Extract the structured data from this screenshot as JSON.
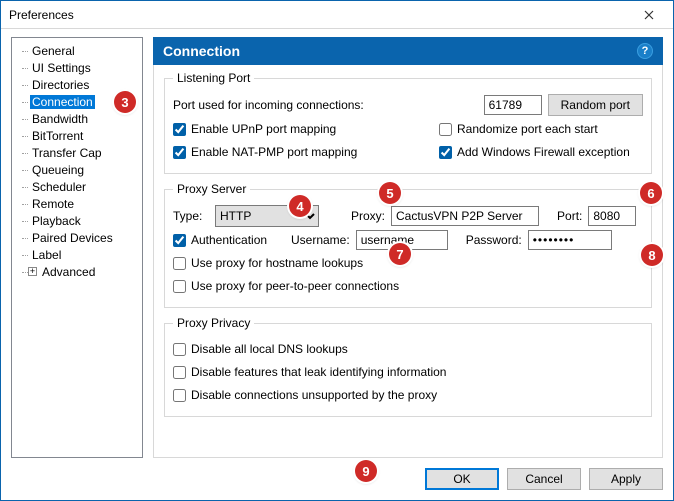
{
  "window": {
    "title": "Preferences"
  },
  "tree": {
    "items": [
      "General",
      "UI Settings",
      "Directories",
      "Connection",
      "Bandwidth",
      "BitTorrent",
      "Transfer Cap",
      "Queueing",
      "Scheduler",
      "Remote",
      "Playback",
      "Paired Devices",
      "Label",
      "Advanced"
    ],
    "selected_index": 3,
    "expandable_index": 13
  },
  "page_header": "Connection",
  "listening_port": {
    "legend": "Listening Port",
    "port_label": "Port used for incoming connections:",
    "port_value": "61789",
    "random_button": "Random port",
    "upnp": {
      "label": "Enable UPnP port mapping",
      "checked": true
    },
    "randomize": {
      "label": "Randomize port each start",
      "checked": false
    },
    "natpmp": {
      "label": "Enable NAT-PMP port mapping",
      "checked": true
    },
    "firewall": {
      "label": "Add Windows Firewall exception",
      "checked": true
    }
  },
  "proxy_server": {
    "legend": "Proxy Server",
    "type_label": "Type:",
    "type_value": "HTTP",
    "proxy_label": "Proxy:",
    "proxy_value": "CactusVPN P2P Server",
    "port_label": "Port:",
    "port_value": "8080",
    "auth": {
      "label": "Authentication",
      "checked": true
    },
    "username_label": "Username:",
    "username_value": "username",
    "password_label": "Password:",
    "password_value": "••••••••",
    "hostname_lookups": {
      "label": "Use proxy for hostname lookups",
      "checked": false
    },
    "p2p": {
      "label": "Use proxy for peer-to-peer connections",
      "checked": false
    }
  },
  "proxy_privacy": {
    "legend": "Proxy Privacy",
    "dns": {
      "label": "Disable all local DNS lookups",
      "checked": false
    },
    "leak": {
      "label": "Disable features that leak identifying information",
      "checked": false
    },
    "unsupported": {
      "label": "Disable connections unsupported by the proxy",
      "checked": false
    }
  },
  "buttons": {
    "ok": "OK",
    "cancel": "Cancel",
    "apply": "Apply"
  },
  "annotations": {
    "3": "3",
    "4": "4",
    "5": "5",
    "6": "6",
    "7": "7",
    "8": "8",
    "9": "9"
  }
}
